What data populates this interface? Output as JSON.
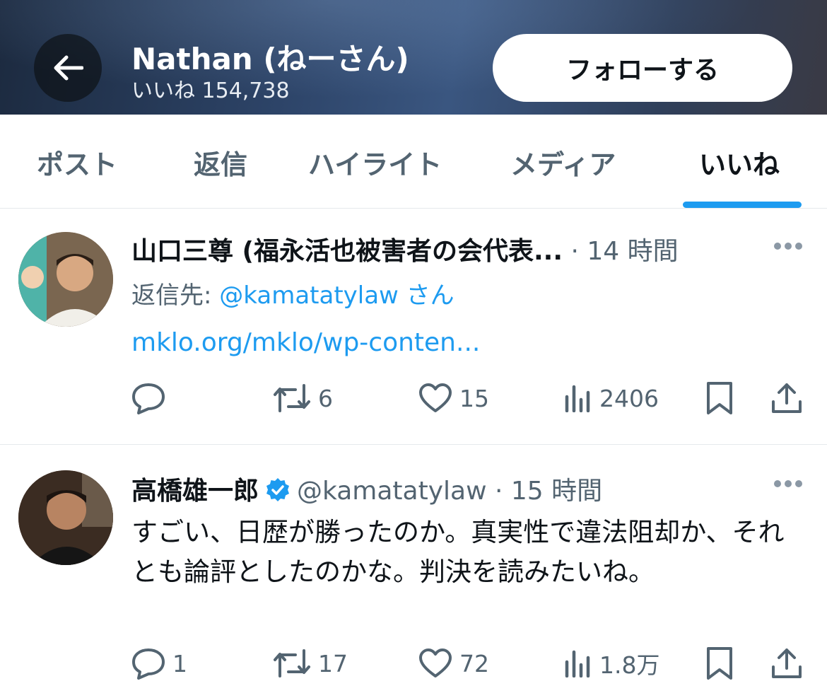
{
  "header": {
    "title": "Nathan (ねーさん)",
    "subtitle": "いいね 154,738",
    "follow_label": "フォローする"
  },
  "tabs": [
    {
      "label": "ポスト",
      "active": false
    },
    {
      "label": "返信",
      "active": false
    },
    {
      "label": "ハイライト",
      "active": false
    },
    {
      "label": "メディア",
      "active": false
    },
    {
      "label": "いいね",
      "active": true
    }
  ],
  "tweets": [
    {
      "name": "山口三尊 (福永活也被害者の会代表...",
      "separator": "·",
      "time": "14 時間",
      "reply_prefix": "返信先: ",
      "reply_handle": "@kamatatylaw",
      "reply_suffix": " さん",
      "link": "mklo.org/mklo/wp-conten...",
      "actions": {
        "replies": "",
        "reposts": "6",
        "likes": "15",
        "views": "2406"
      }
    },
    {
      "name": "高橋雄一郎",
      "verified": true,
      "handle": "@kamatatylaw",
      "separator": "·",
      "time": "15 時間",
      "text": "すごい、日歴が勝ったのか。真実性で違法阻却か、それとも論評としたのかな。判決を読みたいね。",
      "actions": {
        "replies": "1",
        "reposts": "17",
        "likes": "72",
        "views": "1.8万"
      }
    }
  ],
  "colors": {
    "accent": "#1d9bf0",
    "text_primary": "#0f1419",
    "text_secondary": "#536471"
  }
}
